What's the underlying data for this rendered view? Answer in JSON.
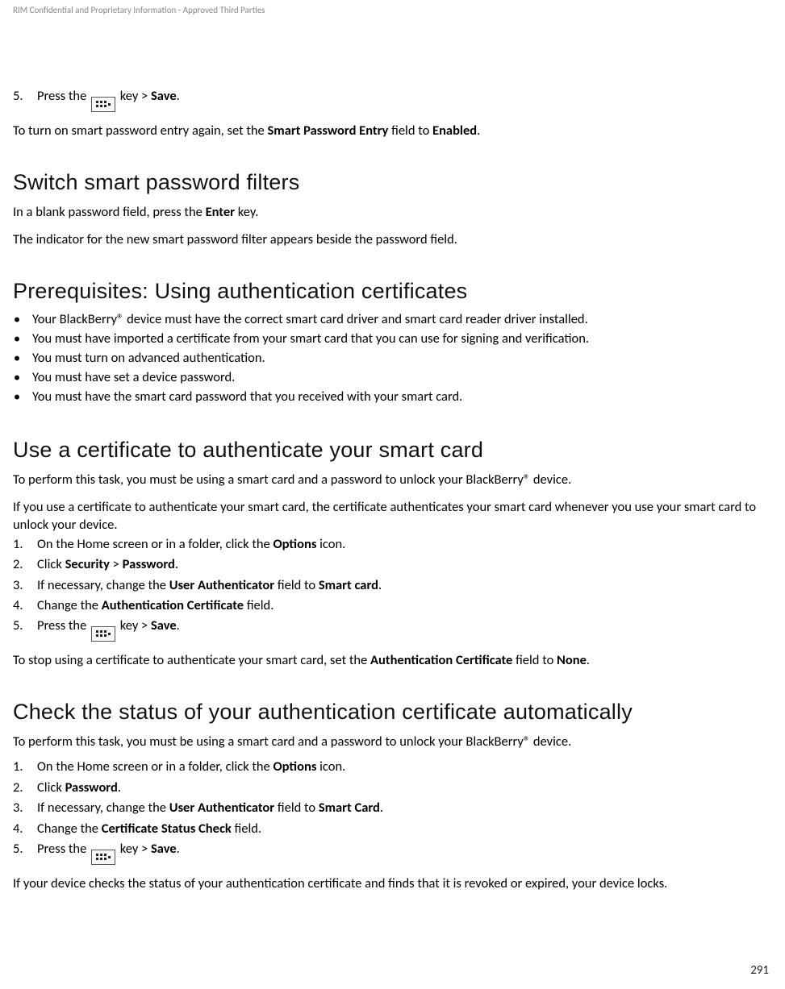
{
  "header": {
    "confidential": "RIM Confidential and Proprietary Information - Approved Third Parties"
  },
  "step5a": {
    "num": "5.",
    "pre": "Press the ",
    "post": " key > ",
    "save": "Save",
    "end": "."
  },
  "para_turn_on": {
    "t1": "To turn on smart password entry again, set the ",
    "b1": "Smart Password Entry",
    "t2": " field to ",
    "b2": "Enabled",
    "t3": "."
  },
  "sec_switch": {
    "title": "Switch smart password filters",
    "p1a": "In a blank password field, press the ",
    "p1b": "Enter",
    "p1c": " key.",
    "p2": "The indicator for the new smart password filter appears beside the password field."
  },
  "sec_prereq": {
    "title": "Prerequisites: Using authentication certificates",
    "items": [
      "Your BlackBerry® device must have the correct smart card driver and smart card reader driver installed.",
      "You must have imported a certificate from your smart card that you can use for signing and verification.",
      "You must turn on advanced authentication.",
      "You must have set a device password.",
      "You must have the smart card password that you received with your smart card."
    ]
  },
  "sec_usecert": {
    "title": "Use a certificate to authenticate your smart card",
    "p1": "To perform this task, you must be using a smart card and a password to unlock your BlackBerry® device.",
    "p2": "If you use a certificate to authenticate your smart card, the certificate authenticates your smart card whenever you use your smart card to unlock your device.",
    "steps": {
      "s1": {
        "num": "1.",
        "t1": "On the Home screen or in a folder, click the ",
        "b1": "Options",
        "t2": " icon."
      },
      "s2": {
        "num": "2.",
        "t1": "Click ",
        "b1": "Security",
        "t2": " > ",
        "b2": "Password",
        "t3": "."
      },
      "s3": {
        "num": "3.",
        "t1": "If necessary, change the ",
        "b1": "User Authenticator",
        "t2": " field to ",
        "b2": "Smart card",
        "t3": "."
      },
      "s4": {
        "num": "4.",
        "t1": "Change the ",
        "b1": "Authentication Certificate",
        "t2": " field."
      },
      "s5": {
        "num": "5.",
        "t1": "Press the ",
        "t2": " key > ",
        "b1": "Save",
        "t3": "."
      }
    },
    "p3": {
      "t1": "To stop using a certificate to authenticate your smart card, set the ",
      "b1": "Authentication Certificate",
      "t2": " field to ",
      "b2": "None",
      "t3": "."
    }
  },
  "sec_check": {
    "title": "Check the status of your authentication certificate automatically",
    "p1": "To perform this task, you must be using a smart card and a password to unlock your BlackBerry® device.",
    "steps": {
      "s1": {
        "num": "1.",
        "t1": "On the Home screen or in a folder, click the ",
        "b1": "Options",
        "t2": " icon."
      },
      "s2": {
        "num": "2.",
        "t1": "Click ",
        "b1": "Password",
        "t2": "."
      },
      "s3": {
        "num": "3.",
        "t1": "If necessary, change the ",
        "b1": "User Authenticator",
        "t2": " field to ",
        "b2": "Smart Card",
        "t3": "."
      },
      "s4": {
        "num": "4.",
        "t1": "Change the ",
        "b1": "Certificate Status Check",
        "t2": " field."
      },
      "s5": {
        "num": "5.",
        "t1": "Press the ",
        "t2": " key > ",
        "b1": "Save",
        "t3": "."
      }
    },
    "p2": "If your device checks the status of your authentication certificate and finds that it is revoked or expired, your device locks."
  },
  "page_number": "291"
}
